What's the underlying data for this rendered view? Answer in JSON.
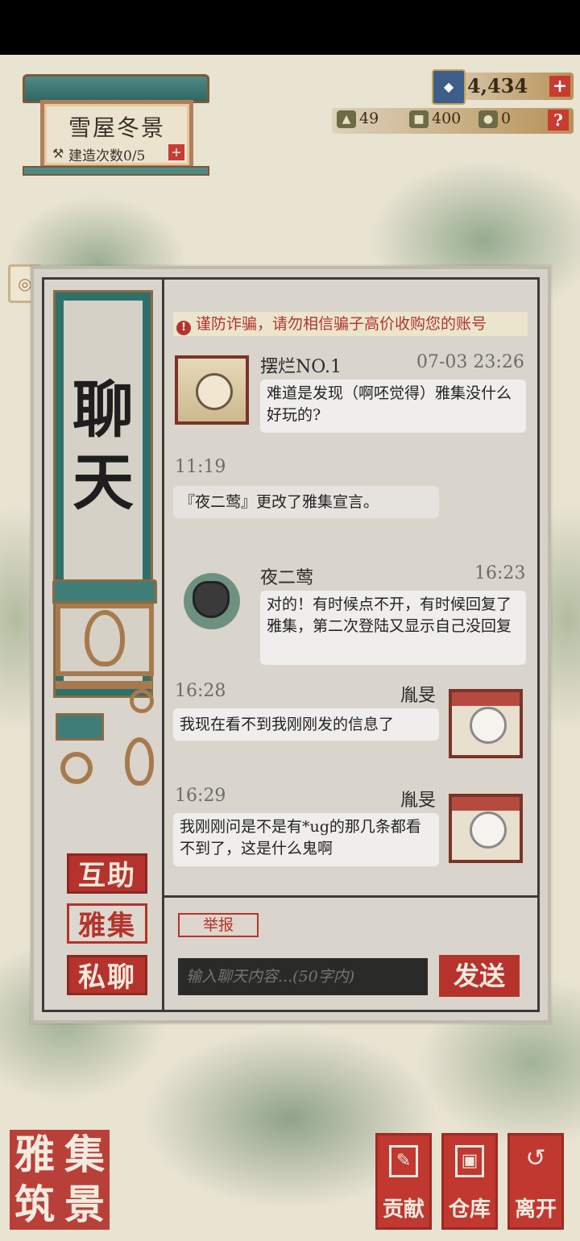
{
  "building": {
    "title": "雪屋冬景",
    "build_count": "建造次数0/5",
    "plus": "+"
  },
  "currency": {
    "main_value": "4,434",
    "plus": "+",
    "help": "?",
    "items": [
      {
        "icon": "wood-icon",
        "value": "49"
      },
      {
        "icon": "stone-icon",
        "value": "400"
      },
      {
        "icon": "jade-icon",
        "value": "0"
      }
    ]
  },
  "chat": {
    "title_chars": [
      "聊",
      "天"
    ],
    "warning": "谨防诈骗，请勿相信骗子高价收购您的账号",
    "warning_mark": "!",
    "messages": [
      {
        "name": "摆烂NO.1",
        "time": "07-03 23:26",
        "text": "难道是发现（啊呸觉得）雅集没什么好玩的?"
      },
      {
        "time": "11:19",
        "text": "『夜二莺』更改了雅集宣言。"
      },
      {
        "name": "夜二莺",
        "time": "16:23",
        "text": "对的！有时候点不开，有时候回复了雅集，第二次登陆又显示自己没回复"
      },
      {
        "name": "胤旻",
        "time": "16:28",
        "text": "我现在看不到我刚刚发的信息了"
      },
      {
        "name": "胤旻",
        "time": "16:29",
        "text": "我刚刚问是不是有*ug的那几条都看不到了，这是什么鬼啊"
      }
    ],
    "tabs": [
      "互助",
      "雅集",
      "私聊"
    ],
    "report": "举报",
    "input_placeholder": "输入聊天内容...(50字内)",
    "send": "发送"
  },
  "logo": [
    "雅",
    "集",
    "筑",
    "景"
  ],
  "bottom_buttons": [
    {
      "label": "贡献",
      "icon": "scroll-icon"
    },
    {
      "label": "仓库",
      "icon": "box-icon"
    },
    {
      "label": "离开",
      "icon": "return-icon"
    }
  ],
  "colors": {
    "accent_red": "#b5332c",
    "teal": "#2e706c",
    "panel": "#d9d5cc"
  }
}
